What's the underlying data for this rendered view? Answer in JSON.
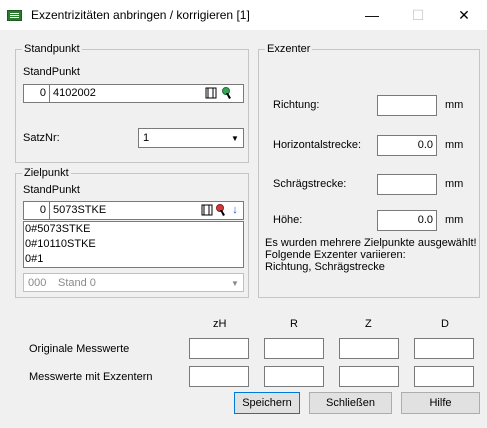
{
  "window": {
    "title": "Exzentrizitäten anbringen / korrigieren [1]",
    "minimize": "—",
    "maximize": "☐",
    "close": "✕"
  },
  "standpunkt": {
    "group_label": "Standpunkt",
    "field_label": "StandPunkt",
    "number": "0",
    "name": "4102002",
    "satznr_label": "SatzNr:",
    "satznr_value": "1"
  },
  "zielpunkt": {
    "group_label": "Zielpunkt",
    "field_label": "StandPunkt",
    "number": "0",
    "name": "5073STKE",
    "dropdown_items": [
      "0#5073STKE",
      "0#10110STKE",
      "0#1"
    ],
    "hidden_combo_number": "000",
    "hidden_combo_text": "Stand 0"
  },
  "exzenter": {
    "group_label": "Exzenter",
    "richtung_label": "Richtung:",
    "richtung_value": "",
    "richtung_unit": "mm",
    "horizontal_label": "Horizontalstrecke:",
    "horizontal_value": "0.0",
    "horizontal_unit": "mm",
    "schraeg_label": "Schrägstrecke:",
    "schraeg_value": "",
    "schraeg_unit": "mm",
    "hoehe_label": "Höhe:",
    "hoehe_value": "0.0",
    "hoehe_unit": "mm",
    "info_line1": "Es wurden mehrere Zielpunkte ausgewählt!",
    "info_line2": "Folgende Exzenter variieren:",
    "info_line3": "Richtung, Schrägstrecke"
  },
  "table": {
    "columns": [
      "zH",
      "R",
      "Z",
      "D"
    ],
    "rows": [
      {
        "label": "Originale Messwerte",
        "values": [
          "",
          "",
          "",
          ""
        ]
      },
      {
        "label": "Messwerte mit Exzentern",
        "values": [
          "",
          "",
          "",
          ""
        ]
      }
    ]
  },
  "buttons": {
    "save": "Speichern",
    "close": "Schließen",
    "help": "Hilfe"
  }
}
